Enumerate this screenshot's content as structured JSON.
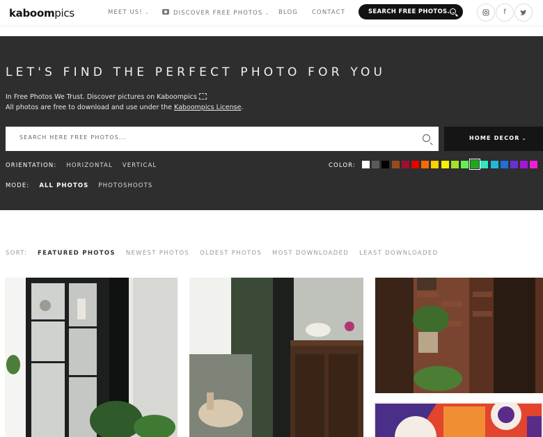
{
  "header": {
    "logo_bold": "kaboom",
    "logo_light": "pics",
    "nav": {
      "meet_us": "MEET US!",
      "discover": "DISCOVER FREE PHOTOS",
      "blog": "BLOG",
      "contact": "CONTACT"
    },
    "search_button": "SEARCH FREE PHOTOS...",
    "social": [
      "instagram-icon",
      "facebook-icon",
      "twitter-icon"
    ]
  },
  "hero": {
    "title": "LET'S FIND THE PERFECT PHOTO FOR YOU",
    "line1": "In Free Photos We Trust. Discover pictures on Kaboompics",
    "line2_prefix": "All photos are free to download and use under the ",
    "license_link": "Kaboompics License",
    "line2_suffix": ".",
    "search_placeholder": "SEARCH HERE FREE PHOTOS...",
    "category": "HOME DECOR",
    "orientation_label": "ORIENTATION:",
    "orientation_options": [
      "HORIZONTAL",
      "VERTICAL"
    ],
    "color_label": "COLOR:",
    "colors": [
      "#ffffff",
      "#5a5a5a",
      "#000000",
      "#9a4a1e",
      "#9b1030",
      "#e60000",
      "#ff6a00",
      "#ffd000",
      "#f5f000",
      "#a6e02a",
      "#66ee55",
      "#1fa81f",
      "#33e6c0",
      "#20b8d6",
      "#1f6fd6",
      "#6a2fd0",
      "#a318d8",
      "#ee1ed8"
    ],
    "selected_color_index": 11,
    "mode_label": "MODE:",
    "mode_options": [
      "ALL PHOTOS",
      "PHOTOSHOOTS"
    ]
  },
  "sort": {
    "label": "SORT:",
    "options": [
      "FEATURED PHOTOS",
      "NEWEST PHOTOS",
      "OLDEST PHOTOS",
      "MOST DOWNLOADED",
      "LEAST DOWNLOADED"
    ],
    "active_index": 0
  },
  "photos": [
    {
      "name": "photo-glass-cabinet",
      "colors": [
        "#1a1d1c",
        "#e8e8e6"
      ]
    },
    {
      "name": "photo-dresser-horse",
      "colors": [
        "#2a2a26",
        "#cfcfc9"
      ]
    },
    {
      "name": "photo-brick-wall-plants",
      "colors": [
        "#6b3a25",
        "#2a1b12"
      ]
    },
    {
      "name": "photo-colorful-art",
      "colors": [
        "#e2442e",
        "#4a2f88"
      ]
    }
  ]
}
